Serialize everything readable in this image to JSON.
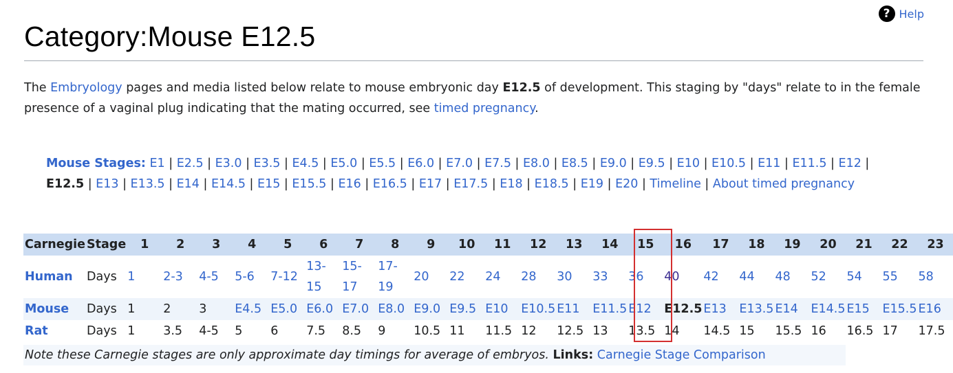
{
  "header": {
    "help_label": "Help",
    "title": "Category:Mouse E12.5"
  },
  "intro": {
    "t1": "The ",
    "link1": "Embryology",
    "t2": " pages and media listed below relate to mouse embryonic day ",
    "bold": "E12.5",
    "t3": " of development. This staging by \"days\" relate to in the female presence of a vaginal plug indicating that the mating occurred, see ",
    "link2": "timed pregnancy",
    "t4": "."
  },
  "stages": {
    "label": "Mouse Stages:",
    "items": [
      "E1",
      "E2.5",
      "E3.0",
      "E3.5",
      "E4.5",
      "E5.0",
      "E5.5",
      "E6.0",
      "E7.0",
      "E7.5",
      "E8.0",
      "E8.5",
      "E9.0",
      "E9.5",
      "E10",
      "E10.5",
      "E11",
      "E11.5",
      "E12",
      "E12.5",
      "E13",
      "E13.5",
      "E14",
      "E14.5",
      "E15",
      "E15.5",
      "E16",
      "E16.5",
      "E17",
      "E17.5",
      "E18",
      "E18.5",
      "E19",
      "E20",
      "Timeline",
      "About timed pregnancy"
    ],
    "current": "E12.5"
  },
  "table": {
    "header": [
      "Carnegie",
      "Stage",
      "1",
      "2",
      "3",
      "4",
      "5",
      "6",
      "7",
      "8",
      "9",
      "10",
      "11",
      "12",
      "13",
      "14",
      "15",
      "16",
      "17",
      "18",
      "19",
      "20",
      "21",
      "22",
      "23"
    ],
    "human": {
      "label": "Human",
      "unit": "Days",
      "values": [
        "1",
        "2-3",
        "4-5",
        "5-6",
        "7-12",
        "13-15",
        "15-17",
        "17-19",
        "20",
        "22",
        "24",
        "28",
        "30",
        "33",
        "36",
        "40",
        "42",
        "44",
        "48",
        "52",
        "54",
        "55",
        "58"
      ]
    },
    "mouse": {
      "label": "Mouse",
      "unit": "Days",
      "values": [
        "1",
        "2",
        "3",
        "E4.5",
        "E5.0",
        "E6.0",
        "E7.0",
        "E8.0",
        "E9.0",
        "E9.5",
        "E10",
        "E10.5",
        "E11",
        "E11.5",
        "E12",
        "E12.5",
        "E13",
        "E13.5",
        "E14",
        "E14.5",
        "E15",
        "E15.5",
        "E16"
      ]
    },
    "rat": {
      "label": "Rat",
      "unit": "Days",
      "values": [
        "1",
        "3.5",
        "4-5",
        "5",
        "6",
        "7.5",
        "8.5",
        "9",
        "10.5",
        "11",
        "11.5",
        "12",
        "12.5",
        "13",
        "13.5",
        "14",
        "14.5",
        "15",
        "15.5",
        "16",
        "16.5",
        "17",
        "17.5"
      ]
    },
    "highlight_stage": "16"
  },
  "note": {
    "text": "Note these Carnegie stages are only approximate day timings for average of embryos.",
    "links_label": "Links:",
    "link": "Carnegie Stage Comparison"
  },
  "colors": {
    "link": "#3366cc",
    "visited": "#3c2d91",
    "header_bg": "#cbdcf2",
    "highlight": "#d32f2f"
  }
}
